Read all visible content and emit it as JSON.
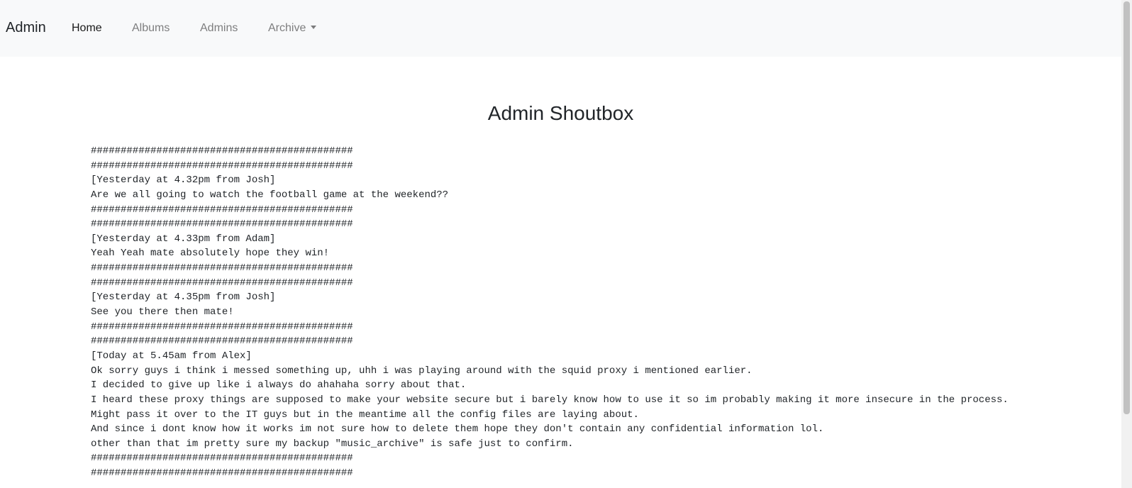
{
  "navbar": {
    "brand": "Admin",
    "links": [
      "Home",
      "Albums",
      "Admins"
    ],
    "dropdown": "Archive"
  },
  "page": {
    "title": "Admin Shoutbox"
  },
  "shoutbox": {
    "lines": [
      "############################################",
      "############################################",
      "[Yesterday at 4.32pm from Josh]",
      "Are we all going to watch the football game at the weekend??",
      "############################################",
      "############################################",
      "[Yesterday at 4.33pm from Adam]",
      "Yeah Yeah mate absolutely hope they win!",
      "############################################",
      "############################################",
      "[Yesterday at 4.35pm from Josh]",
      "See you there then mate!",
      "############################################",
      "############################################",
      "[Today at 5.45am from Alex]",
      "Ok sorry guys i think i messed something up, uhh i was playing around with the squid proxy i mentioned earlier.",
      "I decided to give up like i always do ahahaha sorry about that.",
      "I heard these proxy things are supposed to make your website secure but i barely know how to use it so im probably making it more insecure in the process.",
      "Might pass it over to the IT guys but in the meantime all the config files are laying about.",
      "And since i dont know how it works im not sure how to delete them hope they don't contain any confidential information lol.",
      "other than that im pretty sure my backup \"music_archive\" is safe just to confirm.",
      "############################################",
      "############################################"
    ]
  }
}
